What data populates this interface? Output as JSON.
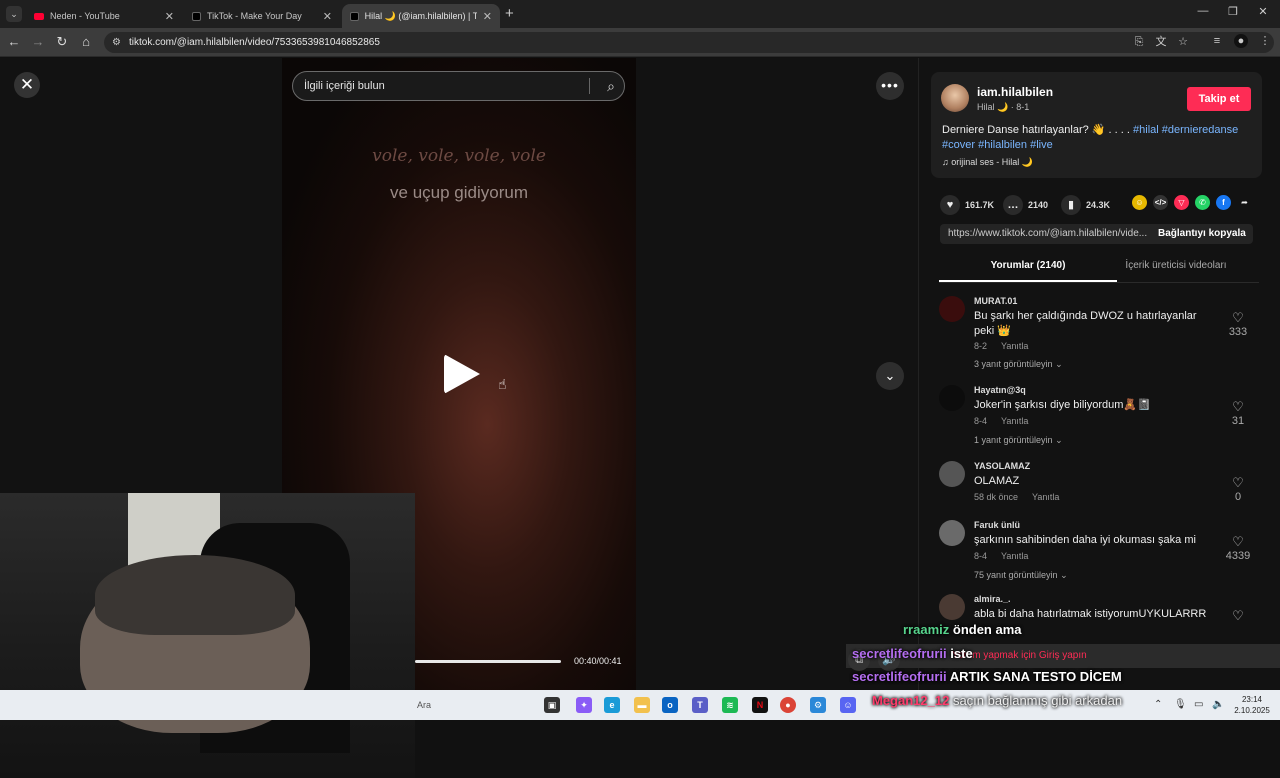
{
  "browser": {
    "tabs": [
      {
        "title": "Neden - YouTube",
        "icon": "youtube-icon"
      },
      {
        "title": "TikTok - Make Your Day",
        "icon": "tiktok-icon"
      },
      {
        "title": "Hilal 🌙 (@iam.hilalbilen) | TikT",
        "icon": "tiktok-icon"
      }
    ],
    "url": "tiktok.com/@iam.hilalbilen/video/7533653981046852865"
  },
  "video": {
    "search_placeholder": "İlgili içeriği bulun",
    "lyric_line1": "vole, vole, vole, vole",
    "lyric_line2": "ve uçup gidiyorum",
    "time": "00:40/00:41",
    "progress": 0.98
  },
  "author": {
    "username": "iam.hilalbilen",
    "display": "Hilal 🌙 · 8-1",
    "follow_label": "Takip et"
  },
  "caption": {
    "text": "Derniere Danse hatırlayanlar? 👋 . . . . ",
    "tags": [
      "#hilal",
      "#dernieredanse",
      "#cover",
      "#hilalbilen",
      "#live"
    ]
  },
  "music": "♫  orijinal ses - Hilal 🌙",
  "stats": {
    "likes": "161.7K",
    "comments": "2140",
    "saves": "24.3K"
  },
  "share": {
    "link": "https://www.tiktok.com/@iam.hilalbilen/vide...",
    "copy_label": "Bağlantıyı kopyala"
  },
  "tabs": {
    "comments": "Yorumlar (2140)",
    "creator_videos": "İçerik üreticisi videoları"
  },
  "comments": [
    {
      "user": "MURAT.01",
      "text": "Bu şarkı her çaldığında DWOZ u hatırlayanlar peki 👑",
      "date": "8-2",
      "reply": "Yanıtla",
      "likes": "333",
      "replies": "3 yanıt görüntüleyin"
    },
    {
      "user": "Hayatın@3q",
      "text": "Joker'in şarkısı diye biliyordum🧸📓",
      "date": "8-4",
      "reply": "Yanıtla",
      "likes": "31",
      "replies": "1 yanıt görüntüleyin"
    },
    {
      "user": "YASOLAMAZ",
      "text": "OLAMAZ",
      "date": "58 dk önce",
      "reply": "Yanıtla",
      "likes": "0",
      "replies": ""
    },
    {
      "user": "Faruk ünlü",
      "text": "şarkının sahibinden daha iyi okuması şaka mi",
      "date": "8-4",
      "reply": "Yanıtla",
      "likes": "4339",
      "replies": "75 yanıt görüntüleyin"
    },
    {
      "user": "almira._.",
      "text": "abla bi daha hatırlatmak istiyorumUYKULARRR",
      "date": "",
      "reply": "",
      "likes": "",
      "replies": ""
    }
  ],
  "login_prompt": "Yorum yapmak için Giriş yapın",
  "chat": [
    {
      "user": "rraamiz",
      "msg": "önden ama",
      "color": "#57d38c"
    },
    {
      "user": "secretlifeofrurii",
      "msg": "iste",
      "color": "#b46ef0"
    },
    {
      "user": "secretlifeofrurii",
      "msg": "ARTIK SANA TESTO DİCEM",
      "color": "#b46ef0"
    },
    {
      "user": "Megan12_12",
      "msg": "saçın bağlanmış gibi arkadan",
      "color": "#ff3b6b"
    }
  ],
  "taskbar": {
    "search": "Ara",
    "time": "23:14",
    "date": "2.10.2025"
  }
}
